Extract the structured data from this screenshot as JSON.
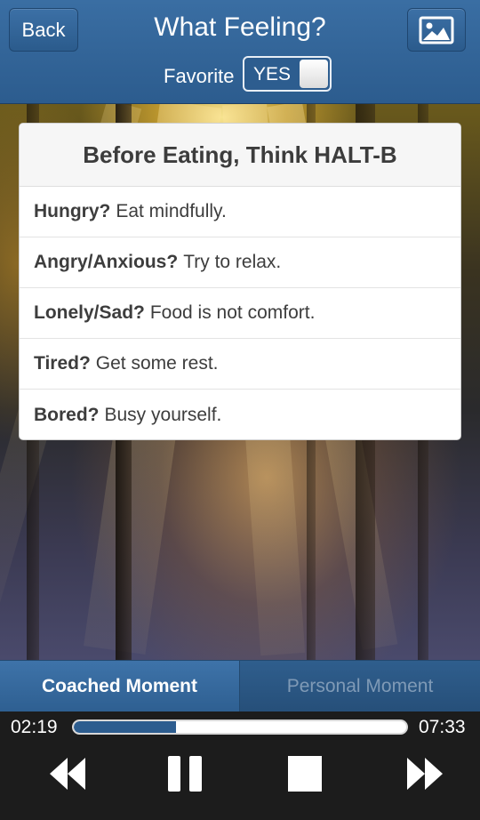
{
  "header": {
    "back_label": "Back",
    "title": "What Feeling?",
    "favorite_label": "Favorite",
    "favorite_toggle": "YES",
    "image_icon": "image-icon"
  },
  "card": {
    "title": "Before Eating, Think HALT-B",
    "items": [
      {
        "question": "Hungry?",
        "advice": "Eat mindfully."
      },
      {
        "question": "Angry/Anxious?",
        "advice": "Try to relax."
      },
      {
        "question": "Lonely/Sad?",
        "advice": "Food is not comfort."
      },
      {
        "question": "Tired?",
        "advice": "Get some rest."
      },
      {
        "question": "Bored?",
        "advice": "Busy yourself."
      }
    ]
  },
  "tabs": [
    {
      "label": "Coached Moment",
      "active": true
    },
    {
      "label": "Personal Moment",
      "active": false
    }
  ],
  "player": {
    "elapsed": "02:19",
    "total": "07:33",
    "progress_fraction": 0.307,
    "controls": [
      "rewind-icon",
      "pause-icon",
      "stop-icon",
      "fast-forward-icon"
    ]
  },
  "colors": {
    "header_blue": "#2c5c8e",
    "progress_fill": "#2d5d8f",
    "player_bg": "#1c1c1c"
  }
}
